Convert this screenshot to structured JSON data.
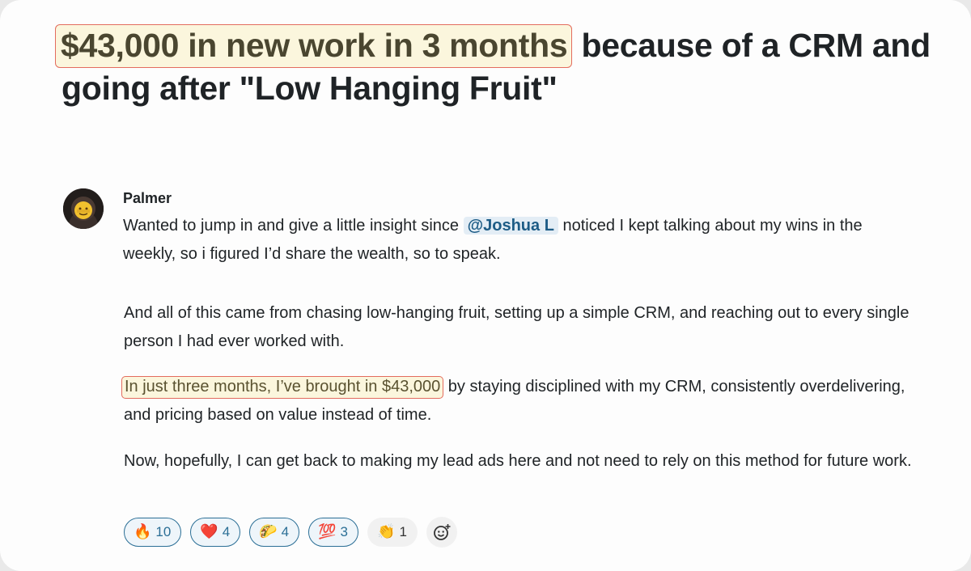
{
  "post": {
    "headline_highlight": "$43,000 in new work in 3 months",
    "headline_rest": " because of a CRM and going after \"Low Hanging Fruit\""
  },
  "message": {
    "author": "Palmer",
    "p1_before": "Wanted to jump in and give a little insight since ",
    "mention": "@Joshua L",
    "p1_after": " noticed I kept talking about my wins in the weekly, so i figured I’d share the wealth, so to speak.",
    "p2": "And all of this came from chasing low-hanging fruit, setting up a simple CRM, and reaching out to every single person I had ever worked with.",
    "p3_highlight": "In just three months, I’ve brought in $43,000",
    "p3_rest": " by staying disciplined with my CRM, consistently overdelivering, and pricing based on value instead of time.",
    "p4": "Now, hopefully, I can get back to making my lead ads here and not need to rely on this method for future work."
  },
  "reactions": [
    {
      "icon": "fire-emoji",
      "glyph": "🔥",
      "count": "10"
    },
    {
      "icon": "heart-emoji",
      "glyph": "❤️",
      "count": "4"
    },
    {
      "icon": "taco-emoji",
      "glyph": "🌮",
      "count": "4"
    },
    {
      "icon": "hundred-points-emoji",
      "glyph": "💯",
      "count": "3"
    },
    {
      "icon": "clapping-hands-emoji",
      "glyph": "👏",
      "count": "1"
    }
  ],
  "colors": {
    "highlight_bg": "#fbf6dd",
    "highlight_border": "#e36c5e",
    "mention_text": "#1d5c86",
    "reaction_border": "#2b6f96"
  }
}
